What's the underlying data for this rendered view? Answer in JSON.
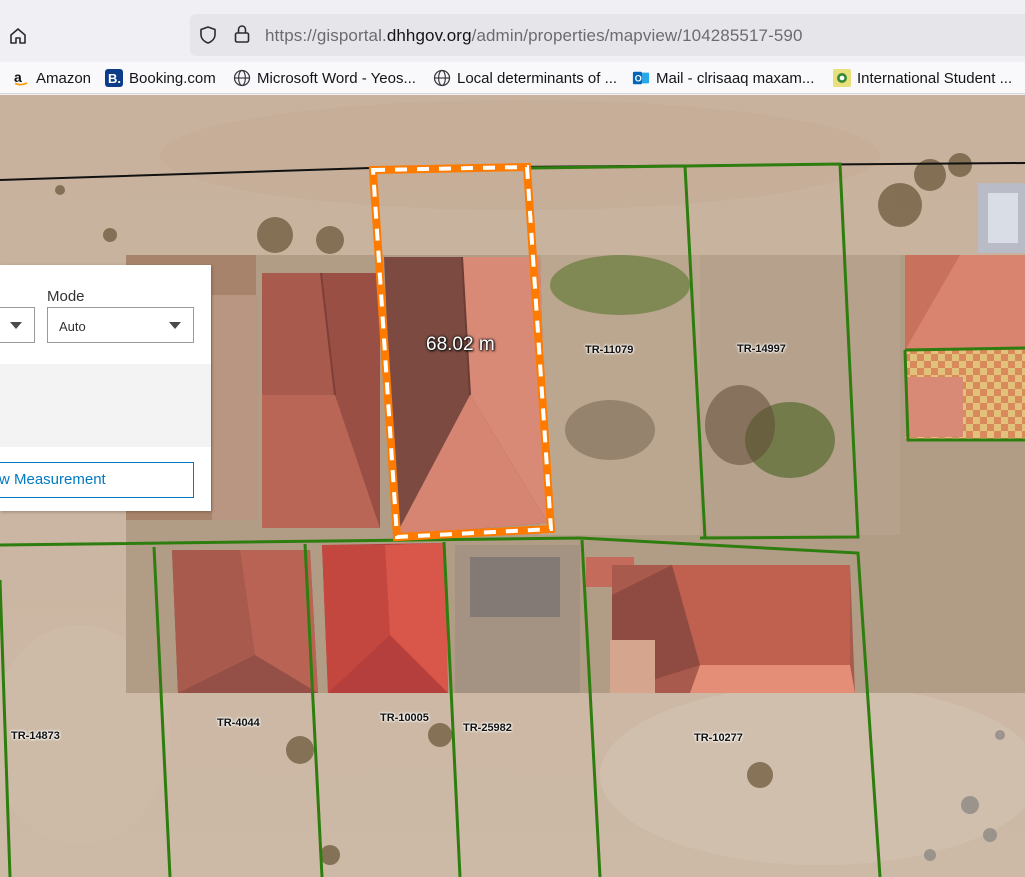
{
  "browser": {
    "url_prefix": "https://gisportal.",
    "url_domain": "dhhgov.org",
    "url_path": "/admin/properties/mapview/104285517-590"
  },
  "bookmarks": [
    {
      "label": "Amazon",
      "icon": "amazon-icon"
    },
    {
      "label": "Booking.com",
      "icon": "booking-icon"
    },
    {
      "label": "Microsoft Word - Yeos...",
      "icon": "globe-icon"
    },
    {
      "label": "Local determinants of ...",
      "icon": "globe-icon"
    },
    {
      "label": "Mail - clrisaaq maxam...",
      "icon": "outlook-icon"
    },
    {
      "label": "International Student ...",
      "icon": "student-icon"
    }
  ],
  "measurement_widget": {
    "mode_label": "Mode",
    "mode_value": "Auto",
    "new_measurement_label": "w Measurement"
  },
  "map": {
    "measurement_value": "68.02 m",
    "parcels": [
      "TR-11079",
      "TR-14997",
      "TR-14873",
      "TR-4044",
      "TR-10005",
      "TR-25982",
      "TR-10277"
    ],
    "colors": {
      "parcel_outline": "#2e7d0f",
      "measurement_outline": "#ff7b00",
      "widget_accent": "#007ac2"
    }
  }
}
